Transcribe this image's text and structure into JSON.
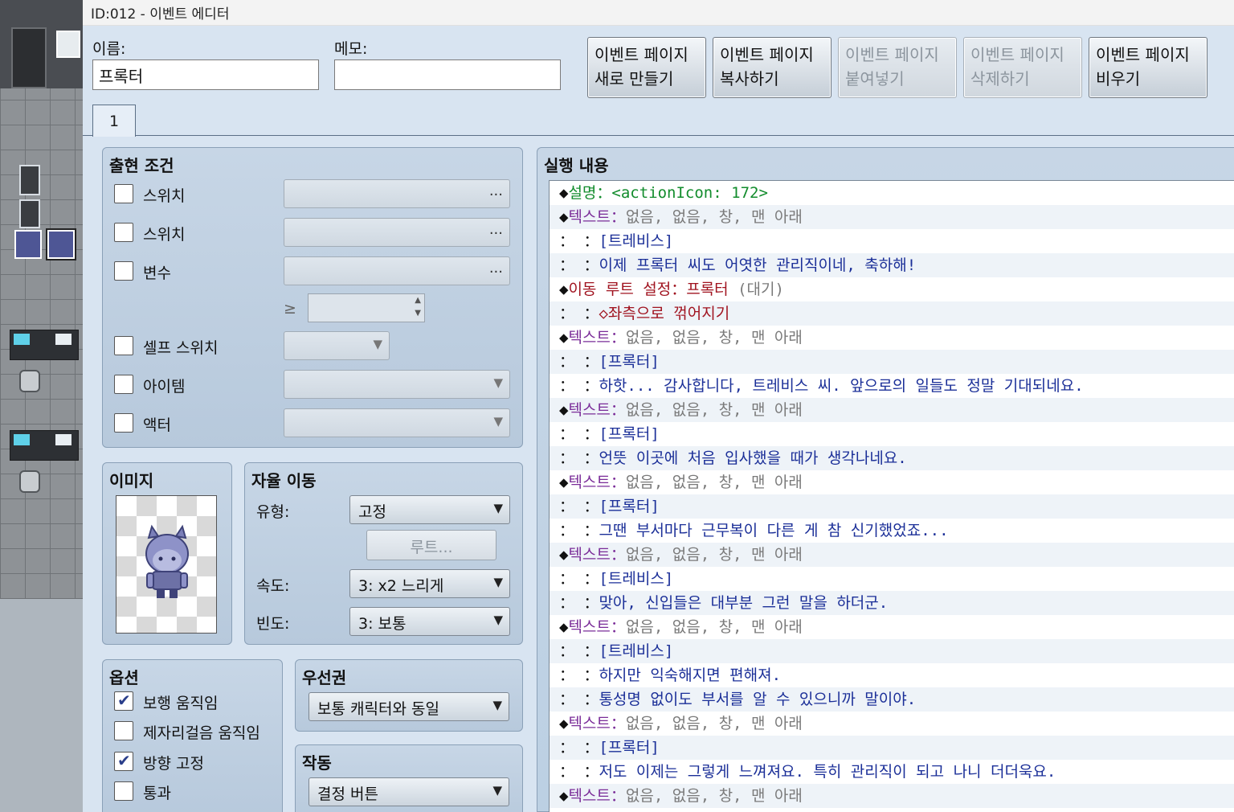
{
  "window": {
    "title": "ID:012 - 이벤트 에디터"
  },
  "fields": {
    "name_label": "이름:",
    "name_value": "프록터",
    "memo_label": "메모:",
    "memo_value": ""
  },
  "page_buttons": [
    {
      "line1": "이벤트 페이지",
      "line2": "새로 만들기",
      "enabled": true
    },
    {
      "line1": "이벤트 페이지",
      "line2": "복사하기",
      "enabled": true
    },
    {
      "line1": "이벤트 페이지",
      "line2": "붙여넣기",
      "enabled": false
    },
    {
      "line1": "이벤트 페이지",
      "line2": "삭제하기",
      "enabled": false
    },
    {
      "line1": "이벤트 페이지",
      "line2": "비우기",
      "enabled": true
    }
  ],
  "tabs": [
    {
      "label": "1"
    }
  ],
  "conditions": {
    "title": "출현 조건",
    "switch1_label": "스위치",
    "switch2_label": "스위치",
    "variable_label": "변수",
    "gte_symbol": "≥",
    "self_switch_label": "셀프 스위치",
    "item_label": "아이템",
    "actor_label": "액터",
    "ellipsis": "..."
  },
  "image": {
    "title": "이미지"
  },
  "autonomous": {
    "title": "자율 이동",
    "type_label": "유형:",
    "type_value": "고정",
    "route_button": "루트...",
    "speed_label": "속도:",
    "speed_value": "3: x2 느리게",
    "freq_label": "빈도:",
    "freq_value": "3: 보통"
  },
  "options": {
    "title": "옵션",
    "items": [
      {
        "label": "보행 움직임",
        "checked": true
      },
      {
        "label": "제자리걸음 움직임",
        "checked": false
      },
      {
        "label": "방향 고정",
        "checked": true
      },
      {
        "label": "통과",
        "checked": false
      }
    ]
  },
  "priority": {
    "title": "우선권",
    "value": "보통 캐릭터와 동일"
  },
  "trigger": {
    "title": "작동",
    "value": "결정 버튼"
  },
  "commands": {
    "title": "실행 내용",
    "rows": [
      [
        {
          "t": "◆",
          "c": "c-diamond"
        },
        {
          "t": "설명：",
          "c": "c-green"
        },
        {
          "t": "<actionIcon: 172>",
          "c": "c-green"
        }
      ],
      [
        {
          "t": "◆",
          "c": "c-diamond"
        },
        {
          "t": "텍스트：",
          "c": "c-purple"
        },
        {
          "t": "없음, 없음, 창, 맨 아래",
          "c": "c-gray"
        }
      ],
      [
        {
          "t": "：        ：",
          "c": "c-black"
        },
        {
          "t": "[트레비스]",
          "c": "c-blue"
        }
      ],
      [
        {
          "t": "：        ：",
          "c": "c-black"
        },
        {
          "t": "이제 프록터 씨도 어엿한 관리직이네, 축하해!",
          "c": "c-blue"
        }
      ],
      [
        {
          "t": "◆",
          "c": "c-diamond"
        },
        {
          "t": "이동 루트 설정：프록터 ",
          "c": "c-maroon"
        },
        {
          "t": "(대기)",
          "c": "c-gray"
        }
      ],
      [
        {
          "t": "：              ：",
          "c": "c-black"
        },
        {
          "t": "◇좌측으로 꺾어지기",
          "c": "c-maroon"
        }
      ],
      [
        {
          "t": "◆",
          "c": "c-diamond"
        },
        {
          "t": "텍스트：",
          "c": "c-purple"
        },
        {
          "t": "없음, 없음, 창, 맨 아래",
          "c": "c-gray"
        }
      ],
      [
        {
          "t": "：        ：",
          "c": "c-black"
        },
        {
          "t": "[프록터]",
          "c": "c-blue"
        }
      ],
      [
        {
          "t": "：        ：",
          "c": "c-black"
        },
        {
          "t": "하핫... 감사합니다, 트레비스 씨. 앞으로의 일들도 정말 기대되네요.",
          "c": "c-blue"
        }
      ],
      [
        {
          "t": "◆",
          "c": "c-diamond"
        },
        {
          "t": "텍스트：",
          "c": "c-purple"
        },
        {
          "t": "없음, 없음, 창, 맨 아래",
          "c": "c-gray"
        }
      ],
      [
        {
          "t": "：        ：",
          "c": "c-black"
        },
        {
          "t": "[프록터]",
          "c": "c-blue"
        }
      ],
      [
        {
          "t": "：        ：",
          "c": "c-black"
        },
        {
          "t": "언뜻 이곳에 처음 입사했을 때가 생각나네요.",
          "c": "c-blue"
        }
      ],
      [
        {
          "t": "◆",
          "c": "c-diamond"
        },
        {
          "t": "텍스트：",
          "c": "c-purple"
        },
        {
          "t": "없음, 없음, 창, 맨 아래",
          "c": "c-gray"
        }
      ],
      [
        {
          "t": "：        ：",
          "c": "c-black"
        },
        {
          "t": "[프록터]",
          "c": "c-blue"
        }
      ],
      [
        {
          "t": "：        ：",
          "c": "c-black"
        },
        {
          "t": "그땐 부서마다 근무복이 다른 게 참 신기했었죠...",
          "c": "c-blue"
        }
      ],
      [
        {
          "t": "◆",
          "c": "c-diamond"
        },
        {
          "t": "텍스트：",
          "c": "c-purple"
        },
        {
          "t": "없음, 없음, 창, 맨 아래",
          "c": "c-gray"
        }
      ],
      [
        {
          "t": "：        ：",
          "c": "c-black"
        },
        {
          "t": "[트레비스]",
          "c": "c-blue"
        }
      ],
      [
        {
          "t": "：        ：",
          "c": "c-black"
        },
        {
          "t": "맞아, 신입들은 대부분 그런 말을 하더군.",
          "c": "c-blue"
        }
      ],
      [
        {
          "t": "◆",
          "c": "c-diamond"
        },
        {
          "t": "텍스트：",
          "c": "c-purple"
        },
        {
          "t": "없음, 없음, 창, 맨 아래",
          "c": "c-gray"
        }
      ],
      [
        {
          "t": "：        ：",
          "c": "c-black"
        },
        {
          "t": "[트레비스]",
          "c": "c-blue"
        }
      ],
      [
        {
          "t": "：        ：",
          "c": "c-black"
        },
        {
          "t": "하지만 익숙해지면 편해져.",
          "c": "c-blue"
        }
      ],
      [
        {
          "t": "：        ：",
          "c": "c-black"
        },
        {
          "t": "통성명 없이도 부서를 알 수 있으니까 말이야.",
          "c": "c-blue"
        }
      ],
      [
        {
          "t": "◆",
          "c": "c-diamond"
        },
        {
          "t": "텍스트：",
          "c": "c-purple"
        },
        {
          "t": "없음, 없음, 창, 맨 아래",
          "c": "c-gray"
        }
      ],
      [
        {
          "t": "：        ：",
          "c": "c-black"
        },
        {
          "t": "[프록터]",
          "c": "c-blue"
        }
      ],
      [
        {
          "t": "：        ：",
          "c": "c-black"
        },
        {
          "t": "저도 이제는 그렇게 느껴져요. 특히 관리직이 되고 나니 더더욱요.",
          "c": "c-blue"
        }
      ],
      [
        {
          "t": "◆",
          "c": "c-diamond"
        },
        {
          "t": "텍스트：",
          "c": "c-purple"
        },
        {
          "t": "없음, 없음, 창, 맨 아래",
          "c": "c-gray"
        }
      ]
    ]
  }
}
